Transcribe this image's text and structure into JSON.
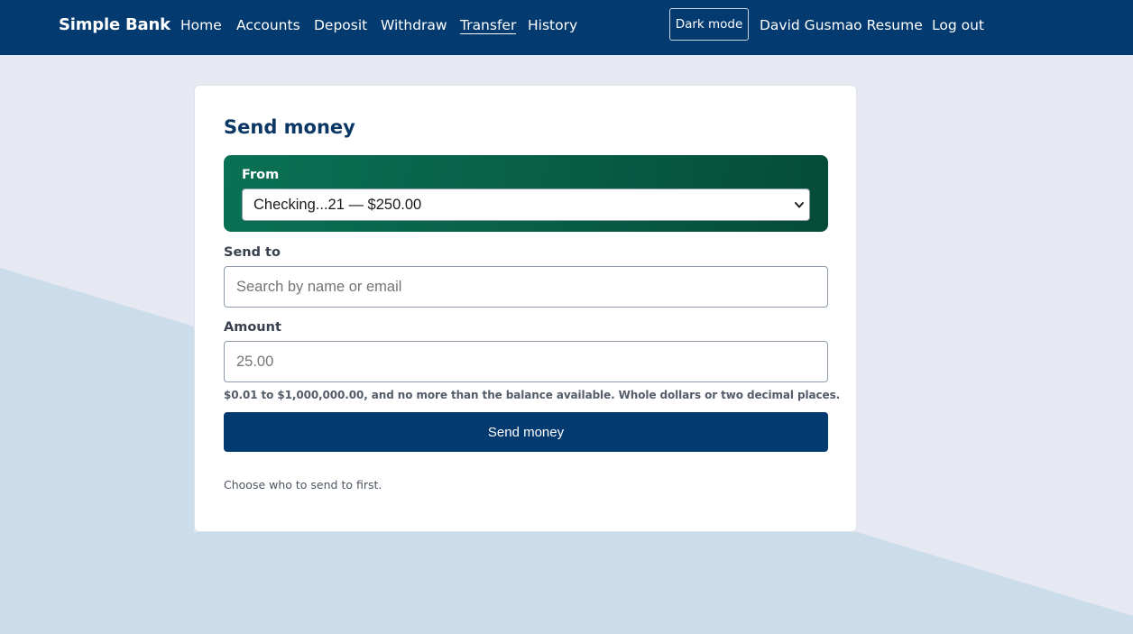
{
  "nav": {
    "brand": "Simple Bank",
    "links": [
      "Home",
      "Accounts",
      "Deposit",
      "Withdraw",
      "Transfer",
      "History"
    ],
    "active": "Transfer",
    "dark_mode": "Dark mode",
    "resume": "David Gusmao Resume",
    "logout": "Log out"
  },
  "form": {
    "title": "Send money",
    "from_label": "From",
    "from_value": "Checking...21 — $250.00",
    "send_to_label": "Send to",
    "send_to_placeholder": "Search by name or email",
    "amount_label": "Amount",
    "amount_placeholder": "25.00",
    "amount_hint": "$0.01 to $1,000,000.00, and no more than the balance available. Whole dollars or two decimal places.",
    "submit": "Send money",
    "status": "Choose who to send to first."
  },
  "colors": {
    "navbar": "#033a70",
    "accent_green": "#0a7154",
    "button": "#033a70",
    "page_bg": "#e6e9f1",
    "bg_shape": "#cbdcea"
  }
}
